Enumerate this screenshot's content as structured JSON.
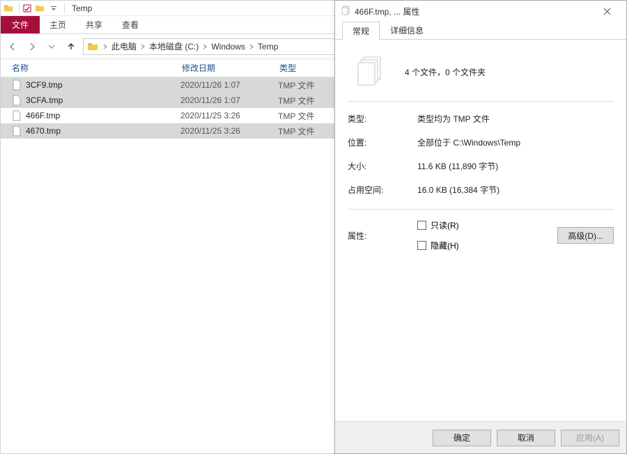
{
  "explorer": {
    "title": "Temp",
    "ribbon": {
      "file": "文件",
      "tabs": [
        "主页",
        "共享",
        "查看"
      ]
    },
    "breadcrumb": [
      "此电脑",
      "本地磁盘 (C:)",
      "Windows",
      "Temp"
    ],
    "columns": {
      "name": "名称",
      "date": "修改日期",
      "type": "类型"
    },
    "files": [
      {
        "name": "3CF9.tmp",
        "date": "2020/11/26 1:07",
        "type": "TMP 文件",
        "selected": true
      },
      {
        "name": "3CFA.tmp",
        "date": "2020/11/26 1:07",
        "type": "TMP 文件",
        "selected": true
      },
      {
        "name": "466F.tmp",
        "date": "2020/11/25 3:26",
        "type": "TMP 文件",
        "selected": false
      },
      {
        "name": "4670.tmp",
        "date": "2020/11/25 3:26",
        "type": "TMP 文件",
        "selected": true
      }
    ]
  },
  "properties": {
    "title": "466F.tmp, ... 属性",
    "tabs": {
      "general": "常规",
      "details": "详细信息"
    },
    "summary": "4 个文件，0 个文件夹",
    "rows": {
      "type_label": "类型:",
      "type_value": "类型均为 TMP 文件",
      "loc_label": "位置:",
      "loc_value": "全部位于 C:\\Windows\\Temp",
      "size_label": "大小:",
      "size_value": "11.6 KB (11,890 字节)",
      "disk_label": "占用空间:",
      "disk_value": "16.0 KB (16,384 字节)"
    },
    "attr_label": "属性:",
    "checks": {
      "readonly": "只读(R)",
      "hidden": "隐藏(H)"
    },
    "advanced": "高级(D)...",
    "buttons": {
      "ok": "确定",
      "cancel": "取消",
      "apply": "应用(A)"
    }
  }
}
